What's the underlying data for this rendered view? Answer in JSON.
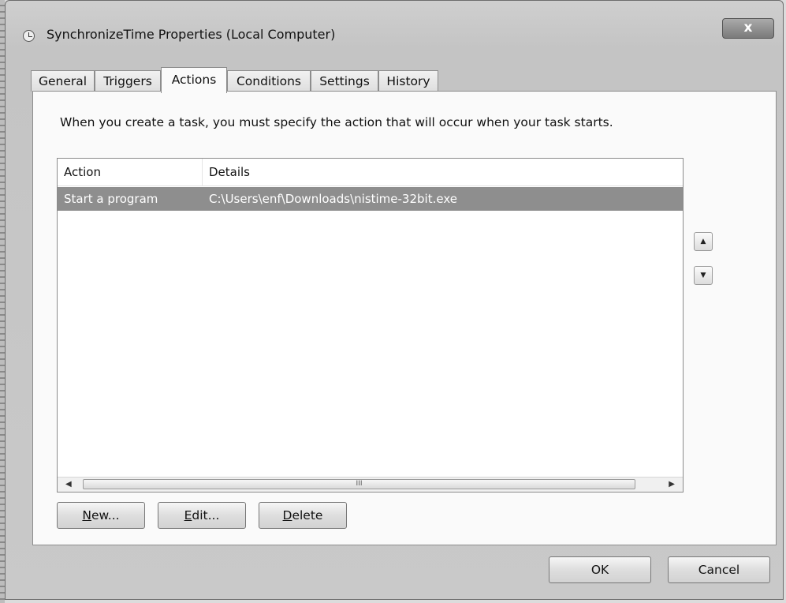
{
  "window": {
    "title": "SynchronizeTime Properties (Local Computer)",
    "close_glyph": "x"
  },
  "tabs": [
    {
      "label": "General"
    },
    {
      "label": "Triggers"
    },
    {
      "label": "Actions",
      "active": true
    },
    {
      "label": "Conditions"
    },
    {
      "label": "Settings"
    },
    {
      "label": "History"
    }
  ],
  "actions_tab": {
    "description": "When you create a task, you must specify the action that will occur when your task starts.",
    "list": {
      "columns": [
        "Action",
        "Details"
      ],
      "rows": [
        {
          "action": "Start a program",
          "details": "C:\\Users\\enf\\Downloads\\nistime-32bit.exe",
          "selected": true
        }
      ],
      "scrollbar_grip": "III"
    },
    "move_up_icon": "chevron-up",
    "move_down_icon": "chevron-down",
    "buttons": {
      "new": {
        "mnemonic": "N",
        "rest": "ew..."
      },
      "edit": {
        "mnemonic": "E",
        "rest": "dit..."
      },
      "delete": {
        "mnemonic": "D",
        "rest": "elete"
      }
    }
  },
  "dialog_buttons": {
    "ok": "OK",
    "cancel": "Cancel"
  },
  "colors": {
    "selection": "#8e8e8e",
    "panel": "#fafafa",
    "chrome": "#c9c9c9"
  }
}
